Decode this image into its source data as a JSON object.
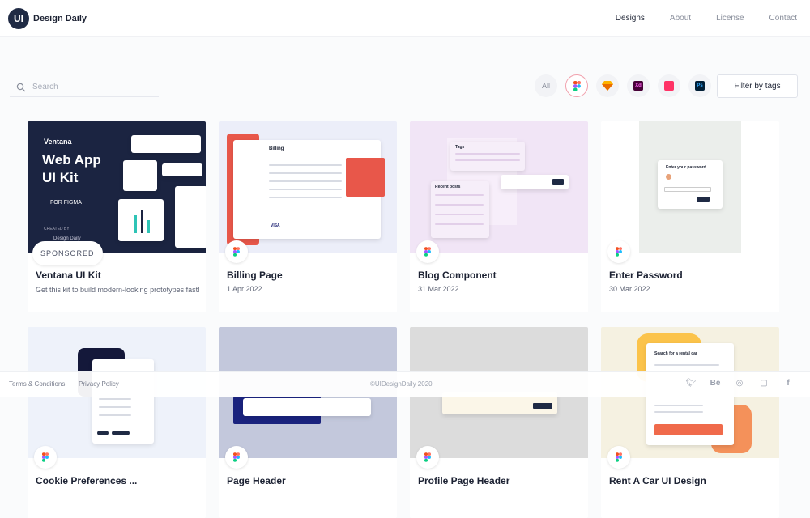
{
  "header": {
    "logo_badge": "UI",
    "logo_text": "Design Daily",
    "nav": [
      "Designs",
      "About",
      "License",
      "Contact"
    ]
  },
  "search": {
    "placeholder": "Search"
  },
  "filters": {
    "all_label": "All",
    "tools": [
      "figma-icon",
      "sketch-icon",
      "xd-icon",
      "invision-icon",
      "photoshop-icon"
    ],
    "tag_button": "Filter by tags"
  },
  "cards_row1": [
    {
      "title": "Ventana UI Kit",
      "desc": "Get this kit to build modern-looking prototypes fast!",
      "badge": "SPONSORED",
      "thumb_title": "Web App",
      "thumb_title2": "UI Kit",
      "thumb_brand": "Ventana",
      "thumb_tag": "FOR FIGMA",
      "thumb_created": "CREATED BY",
      "thumb_author": "Design Daily"
    },
    {
      "title": "Billing Page",
      "date": "1 Apr 2022",
      "thumb_heading": "Billing",
      "thumb_visa": "VISA"
    },
    {
      "title": "Blog Component",
      "date": "31 Mar 2022",
      "thumb_tags": "Tags",
      "thumb_recent": "Recent posts"
    },
    {
      "title": "Enter Password",
      "date": "30 Mar 2022",
      "thumb_heading": "Enter your password"
    }
  ],
  "cards_row2": [
    {
      "title": "Cookie Preferences ..."
    },
    {
      "title": "Page Header"
    },
    {
      "title": "Profile Page Header"
    },
    {
      "title": "Rent A Car UI Design",
      "thumb_heading": "Search for a rental car"
    }
  ],
  "footer": {
    "terms": "Terms & Conditions",
    "privacy": "Privacy Policy",
    "copyright": "©UIDesignDaily 2020",
    "social": [
      "twitter-icon",
      "behance-icon",
      "dribbble-icon",
      "instagram-icon",
      "facebook-icon"
    ]
  },
  "colors": {
    "navy": "#1f2a44",
    "accent": "#e8574a",
    "figma_red": "#f24e1e"
  }
}
